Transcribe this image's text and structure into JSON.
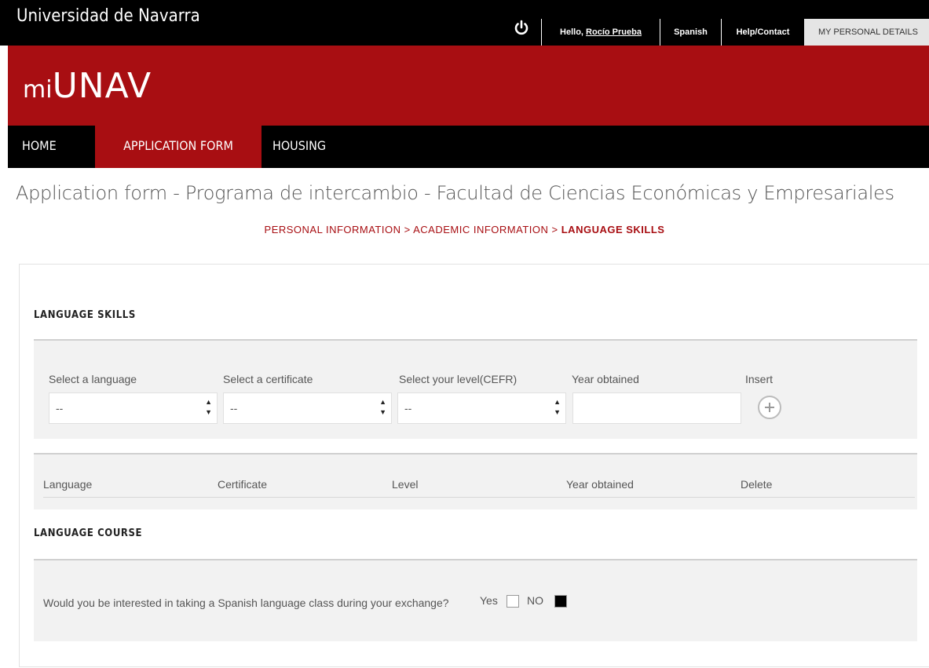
{
  "topbar": {
    "brand": "Universidad de Navarra",
    "hello_prefix": "Hello, ",
    "user_name": "Rocío Prueba",
    "language": "Spanish",
    "help": "Help/Contact",
    "my_details": "MY PERSONAL DETAILS"
  },
  "banner": {
    "logo_mi": "mi",
    "logo_unav": "UNAV"
  },
  "nav": {
    "home": "HOME",
    "application_form": "APPLICATION FORM",
    "housing": "HOUSING"
  },
  "page": {
    "title": "Application form - Programa de intercambio - Facultad de Ciencias Económicas y Empresariales",
    "breadcrumb": {
      "step1": "PERSONAL INFORMATION",
      "step2": "ACADEMIC INFORMATION",
      "step3": "LANGUAGE SKILLS",
      "separator": ">"
    }
  },
  "language_skills": {
    "heading": "LANGUAGE SKILLS",
    "form": {
      "language_label": "Select a language",
      "language_value": "--",
      "certificate_label": "Select a certificate",
      "certificate_value": "--",
      "level_label": "Select your level(CEFR)",
      "level_value": "--",
      "year_label": "Year obtained",
      "year_value": "",
      "insert_label": "Insert"
    },
    "table": {
      "headers": [
        "Language",
        "Certificate",
        "Level",
        "Year obtained",
        "Delete"
      ]
    }
  },
  "language_course": {
    "heading": "LANGUAGE COURSE",
    "question": "Would you be interested in taking a Spanish language class during your exchange?",
    "yes_label": "Yes",
    "no_label": "NO",
    "selected": "NO"
  },
  "colors": {
    "brand_red": "#a80e12",
    "topbar": "#000000",
    "panel_gray": "#f2f2f2"
  }
}
